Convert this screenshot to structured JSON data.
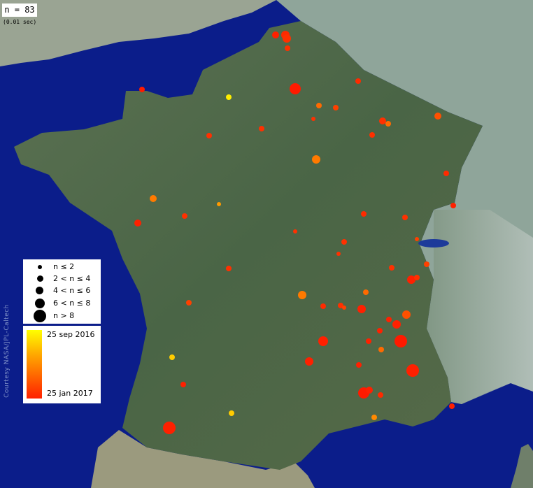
{
  "map": {
    "count_label": "n = 83",
    "elapsed_label": "(0.01 sec)",
    "credit": "Courtesy NASA/JPL-Caltech"
  },
  "legend": {
    "sizes": [
      {
        "label": "n ≤ 2"
      },
      {
        "label": "2 < n ≤ 4"
      },
      {
        "label": "4 < n ≤ 6"
      },
      {
        "label": "6 < n ≤ 8"
      },
      {
        "label": "n > 8"
      }
    ],
    "time_start": "25 sep 2016",
    "time_end": "25 jan 2017"
  },
  "colors": {
    "sea": "#0b1d8a",
    "land": "#4c6a47",
    "foreign_land": "#8fa59a",
    "recent": "#ff2000",
    "old": "#ffff00"
  }
}
